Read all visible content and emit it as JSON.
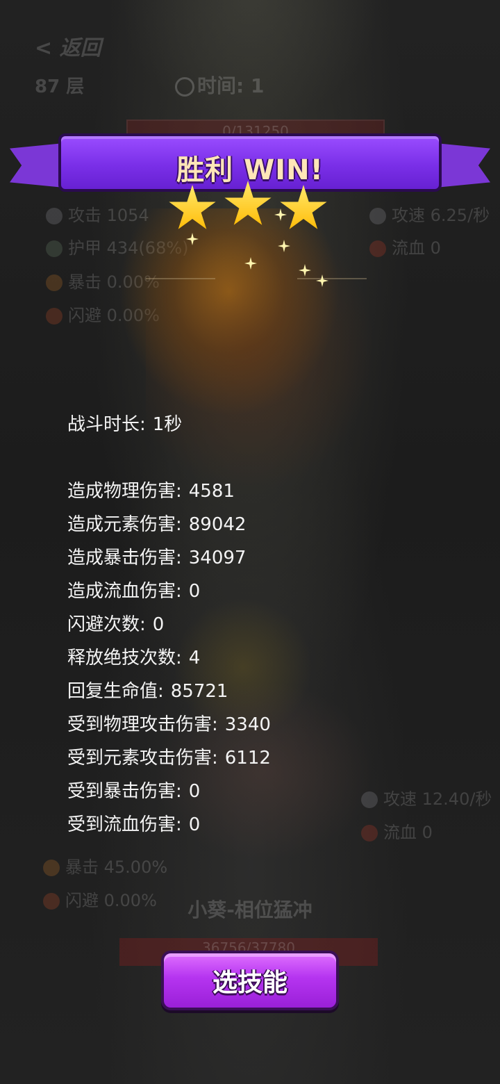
{
  "top_hud": {
    "back_label": "< 返回",
    "floor": "87 层",
    "time_label": "时间:",
    "time_value": "1",
    "enemy_hp": "0/131250"
  },
  "enemy_stats": {
    "attack": "攻击 1054",
    "armor": "护甲 434(68%)",
    "crit": "暴击 0.00%",
    "dodge": "闪避 0.00%",
    "atk_speed": "攻速 6.25/秒",
    "bleed": "流血 0"
  },
  "banner": {
    "title": "胜利 WIN!",
    "stars": 3,
    "colors": {
      "ribbon": "#7a2fe8",
      "title_text": "#ffe6b8",
      "star": "#ffcc1a"
    }
  },
  "results": [
    {
      "label": "战斗时长:",
      "value": "1秒"
    },
    {
      "label": "造成物理伤害:",
      "value": "4581"
    },
    {
      "label": "造成元素伤害:",
      "value": "89042"
    },
    {
      "label": "造成暴击伤害:",
      "value": "34097"
    },
    {
      "label": "造成流血伤害:",
      "value": "0"
    },
    {
      "label": "闪避次数:",
      "value": "0"
    },
    {
      "label": "释放绝技次数:",
      "value": "4"
    },
    {
      "label": "回复生命值:",
      "value": "85721"
    },
    {
      "label": "受到物理攻击伤害:",
      "value": "3340"
    },
    {
      "label": "受到元素攻击伤害:",
      "value": "6112"
    },
    {
      "label": "受到暴击伤害:",
      "value": "0"
    },
    {
      "label": "受到流血伤害:",
      "value": "0"
    }
  ],
  "hero_stats": {
    "atk_speed": "攻速 12.40/秒",
    "bleed": "流血 0",
    "crit": "暴击 45.00%",
    "dodge": "闪避 0.00%"
  },
  "hero_name": "小葵-相位猛冲",
  "hero_hp": "36756/37780",
  "action_button": {
    "label": "选技能",
    "color": "#b534f0"
  }
}
